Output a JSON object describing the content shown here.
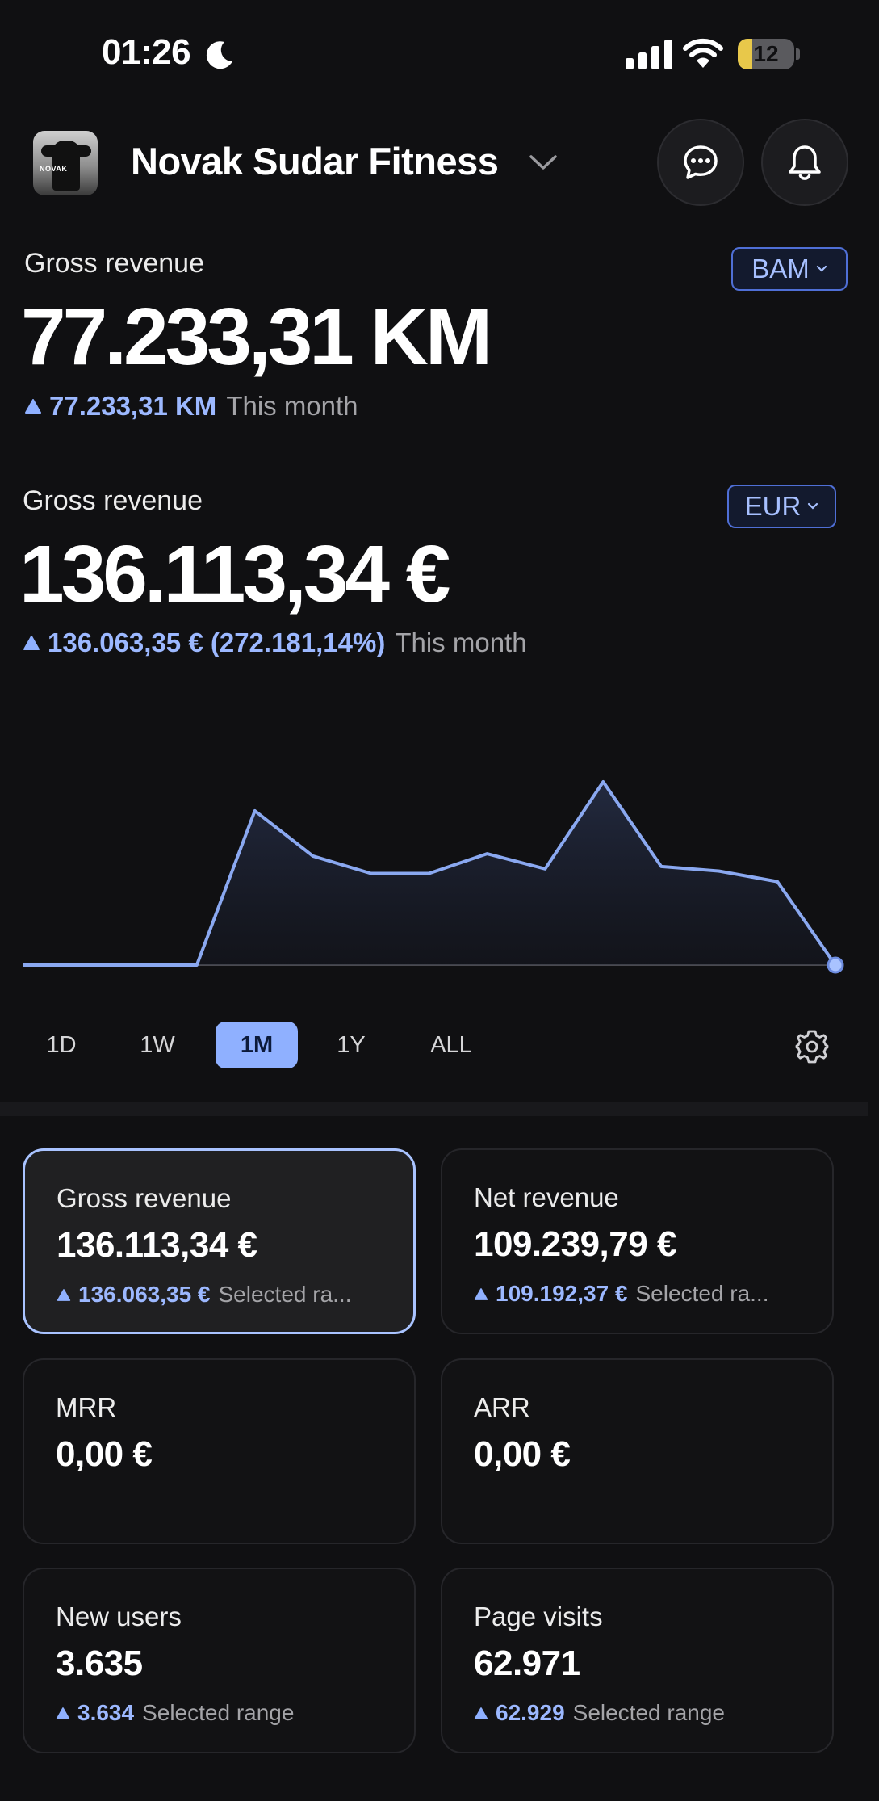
{
  "status_bar": {
    "time": "01:26",
    "battery": "12"
  },
  "header": {
    "brand_name": "Novak Sudar Fitness",
    "avatar_text": "NOVAK"
  },
  "revenue_bam": {
    "label": "Gross revenue",
    "currency_button": "BAM",
    "amount": "77.233,31 KM",
    "delta": "77.233,31 KM",
    "period": "This month"
  },
  "revenue_eur": {
    "label": "Gross revenue",
    "currency_button": "EUR",
    "amount": "136.113,34 €",
    "delta": "136.063,35 € (272.181,14%)",
    "period": "This month"
  },
  "chart_data": {
    "type": "area",
    "x": [
      1,
      2,
      3,
      4,
      5,
      6,
      7,
      8,
      9,
      10,
      11,
      12,
      13,
      14,
      15
    ],
    "values": [
      0,
      0,
      0,
      0,
      13.3,
      9.4,
      7.9,
      7.9,
      9.6,
      8.3,
      15.8,
      8.5,
      8.1,
      7.2,
      0
    ],
    "colors": {
      "line": "#8aa8f0"
    }
  },
  "ranges": {
    "tabs": [
      "1D",
      "1W",
      "1M",
      "1Y",
      "ALL"
    ],
    "selected": "1M"
  },
  "metrics": [
    {
      "title": "Gross revenue",
      "value": "136.113,34 €",
      "delta": "136.063,35 €",
      "note": "Selected ra...",
      "selected": true
    },
    {
      "title": "Net revenue",
      "value": "109.239,79 €",
      "delta": "109.192,37 €",
      "note": "Selected ra...",
      "selected": false
    },
    {
      "title": "MRR",
      "value": "0,00 €",
      "delta": "",
      "note": "",
      "selected": false
    },
    {
      "title": "ARR",
      "value": "0,00 €",
      "delta": "",
      "note": "",
      "selected": false
    },
    {
      "title": "New users",
      "value": "3.635",
      "delta": "3.634",
      "note": "Selected range",
      "selected": false
    },
    {
      "title": "Page visits",
      "value": "62.971",
      "delta": "62.929",
      "note": "Selected range",
      "selected": false
    }
  ],
  "colors": {
    "accent": "#8fb0ff",
    "delta_text": "#9cb8ff",
    "background": "#101012"
  },
  "icons": [
    "moon-icon",
    "signal-icon",
    "wifi-icon",
    "chat-icon",
    "bell-icon",
    "gear-icon",
    "chevron-down-icon",
    "triangle-up-icon"
  ]
}
